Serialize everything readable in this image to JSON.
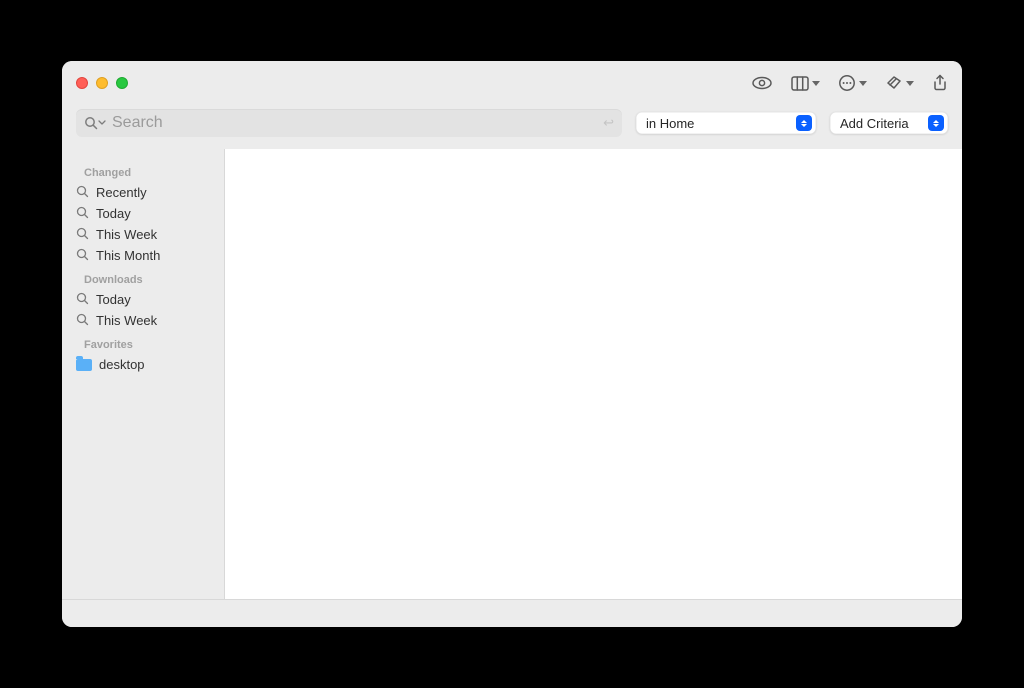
{
  "search": {
    "placeholder": "Search"
  },
  "toolbar": {
    "scope_label": "in Home",
    "criteria_label": "Add Criteria"
  },
  "sidebar": {
    "groups": [
      {
        "header": "Changed",
        "items": [
          {
            "label": "Recently",
            "icon": "glass"
          },
          {
            "label": "Today",
            "icon": "glass"
          },
          {
            "label": "This Week",
            "icon": "glass"
          },
          {
            "label": "This Month",
            "icon": "glass"
          }
        ]
      },
      {
        "header": "Downloads",
        "items": [
          {
            "label": "Today",
            "icon": "glass"
          },
          {
            "label": "This Week",
            "icon": "glass"
          }
        ]
      },
      {
        "header": "Favorites",
        "items": [
          {
            "label": "desktop",
            "icon": "folder"
          }
        ]
      }
    ]
  }
}
